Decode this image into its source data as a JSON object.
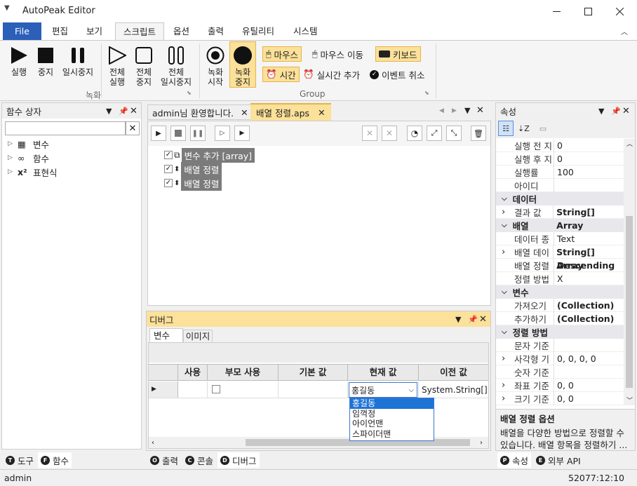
{
  "app": {
    "title": "AutoPeak Editor",
    "status_user": "admin",
    "status_right": "52077:12:10"
  },
  "ribbon_tabs": [
    "File",
    "편집",
    "보기",
    "스크립트",
    "옵션",
    "출력",
    "유틸리티",
    "시스템"
  ],
  "ribbon": {
    "rec_group": "녹화",
    "group2": "Group",
    "run": "실행",
    "stop": "중지",
    "pause": "일시중지",
    "run_all": [
      "전체",
      "실행"
    ],
    "stop_all": [
      "전체",
      "중지"
    ],
    "pause_all": [
      "전체",
      "일시중지"
    ],
    "rec_start": [
      "녹화",
      "시작"
    ],
    "rec_stop": [
      "녹화",
      "중지"
    ],
    "mouse": "마우스",
    "mouse_move": "마우스 이동",
    "keyboard": "키보드",
    "time": "시간",
    "realtime_add": "실시간 추가",
    "event_cancel": "이벤트 취소"
  },
  "func_box": {
    "title": "함수 상자",
    "search_placeholder": "",
    "items": [
      "변수",
      "함수",
      "표현식"
    ]
  },
  "doc_tabs": [
    {
      "label": "admin님 환영합니다."
    },
    {
      "label": "배열 정렬.aps"
    }
  ],
  "script_nodes": [
    "변수 추가 [array]",
    "배열 정렬",
    "배열 정렬"
  ],
  "debug": {
    "title": "디버그",
    "tabs": [
      "변수",
      "이미지"
    ],
    "columns": [
      "사용",
      "부모 사용",
      "기본 값",
      "현재 값",
      "이전 값"
    ],
    "current_value": "홍길동",
    "previous_value": "System.String[]",
    "dropdown": [
      "홍길동",
      "임꺽정",
      "아이언맨",
      "스파이더맨"
    ]
  },
  "left_bottom_tabs": [
    {
      "key": "T",
      "label": "도구"
    },
    {
      "key": "F",
      "label": "함수"
    }
  ],
  "center_bottom_tabs": [
    {
      "key": "O",
      "label": "출력"
    },
    {
      "key": "C",
      "label": "콘솔"
    },
    {
      "key": "D",
      "label": "디버그"
    }
  ],
  "right_bottom_tabs": [
    {
      "key": "P",
      "label": "속성"
    },
    {
      "key": "E",
      "label": "외부 API"
    }
  ],
  "props": {
    "title": "속성",
    "rows": [
      {
        "k": "실행 전 지",
        "v": "0"
      },
      {
        "k": "실행 후 지",
        "v": "0"
      },
      {
        "k": "실행률",
        "v": "100"
      },
      {
        "k": "아이디",
        "v": ""
      },
      {
        "cat": "데이터"
      },
      {
        "k": "결과 값",
        "v": "String[] Array",
        "bold": true,
        "exp": true
      },
      {
        "cat": "배열"
      },
      {
        "k": "데이터 종",
        "v": "Text"
      },
      {
        "k": "배열 데이",
        "v": "String[] Array",
        "bold": true,
        "exp": true
      },
      {
        "k": "배열 정렬",
        "v": "Descending",
        "bold": true
      },
      {
        "k": "정렬 방법",
        "v": "X"
      },
      {
        "cat": "변수"
      },
      {
        "k": "가져오기",
        "v": "(Collection)",
        "bold": true
      },
      {
        "k": "추가하기",
        "v": "(Collection)",
        "bold": true
      },
      {
        "cat": "정렬 방법"
      },
      {
        "k": "문자 기준",
        "v": ""
      },
      {
        "k": "사각형 기",
        "v": "0, 0, 0, 0",
        "exp": true
      },
      {
        "k": "숫자 기준",
        "v": ""
      },
      {
        "k": "좌표 기준",
        "v": "0, 0",
        "exp": true
      },
      {
        "k": "크기 기준",
        "v": "0, 0",
        "exp": true
      }
    ],
    "desc_title": "배열 정렬 옵션",
    "desc_text": "배열을 다양한 방법으로 정렬할 수 있습니다. 배열 항목을 정렬하기 ..."
  }
}
